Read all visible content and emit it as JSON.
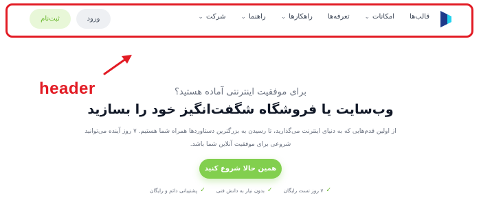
{
  "header": {
    "logo_icon": "brand-logo-icon",
    "nav": [
      {
        "label": "قالب‌ها",
        "has_dropdown": false
      },
      {
        "label": "امکانات",
        "has_dropdown": true
      },
      {
        "label": "تعرفه‌ها",
        "has_dropdown": false
      },
      {
        "label": "راهکارها",
        "has_dropdown": true
      },
      {
        "label": "راهنما",
        "has_dropdown": true
      },
      {
        "label": "شرکت",
        "has_dropdown": true
      }
    ],
    "login_label": "ورود",
    "signup_label": "ثبت‌نام"
  },
  "annotation": {
    "label": "header",
    "color": "#e21b24"
  },
  "hero": {
    "subtitle": "برای موفقیت اینترنتی آماده هستید؟",
    "title": "وب‌سایت یا فروشگاه شگفت‌انگیز خود را بسازید",
    "description": "از اولین قدم‌هایی که به دنیای اینترنت می‌گذارید، تا رسیدن به بزرگترین دستاوردها همراه شما هستیم. ۷ روز آینده می‌توانید شروعی برای موفقیت آنلاین شما باشد.",
    "cta_label": "همین حالا شروع کنید",
    "features": [
      "۷ روز تست رایگان",
      "بدون نیاز به دانش فنی",
      "پشتیبانی دائم و رایگان"
    ]
  },
  "colors": {
    "accent": "#82cf4e",
    "accent_soft": "#e8f7d8",
    "annotation_red": "#e21b24"
  }
}
